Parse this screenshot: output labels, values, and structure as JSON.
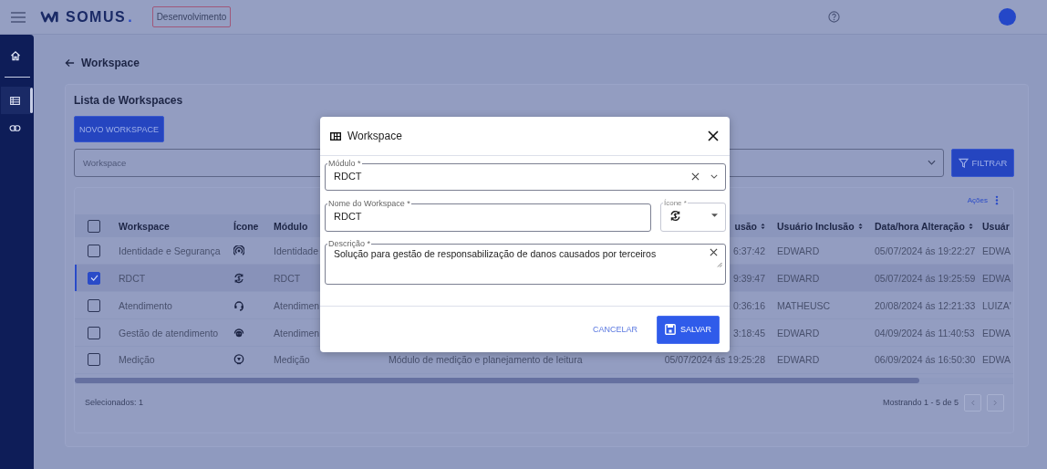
{
  "app_bar": {
    "logo_text": "SOMUS",
    "logo_dot": ".",
    "environment_badge": "Desenvolvimento"
  },
  "sidebar": {
    "items": [
      {
        "kind": "home",
        "selected": false
      },
      {
        "kind": "list",
        "selected": true
      },
      {
        "kind": "link",
        "selected": false
      }
    ]
  },
  "page_title": "Workspace",
  "card": {
    "title": "Lista de Workspaces",
    "new_button": "NOVO WORKSPACE",
    "filter": {
      "placeholder": "Workspace"
    },
    "filter_button": "FILTRAR",
    "actions": "Ações"
  },
  "table": {
    "select_all_checked": false,
    "columns": [
      {
        "label": "Workspace",
        "sortable": false
      },
      {
        "label": "Ícone",
        "sortable": false
      },
      {
        "label": "Módulo",
        "sortable": false
      },
      {
        "label": "usão",
        "sortable": true
      },
      {
        "label": "Usuário Inclusão",
        "sortable": true
      },
      {
        "label": "Data/hora Alteração",
        "sortable": true
      },
      {
        "label": "Usuár",
        "sortable": false
      }
    ],
    "rows": [
      {
        "selected": false,
        "workspace": "Identidade e Segurança",
        "modulo": "Identidade",
        "data_inclusao": "6:37:42",
        "usuario_inclusao": "EDWARD",
        "data_alteracao": "05/07/2024 ás 19:22:27",
        "column_9": "EDWA"
      },
      {
        "selected": true,
        "workspace": "RDCT",
        "modulo": "RDCT",
        "data_inclusao": "9:39:47",
        "usuario_inclusao": "EDWARD",
        "data_alteracao": "05/07/2024 ás 19:25:59",
        "column_9": "EDWA"
      },
      {
        "selected": false,
        "workspace": "Atendimento",
        "modulo": "Atendimen",
        "data_inclusao": "0:36:16",
        "usuario_inclusao": "MATHEUSC",
        "data_alteracao": "20/08/2024 ás 12:21:33",
        "column_9": "LUIZA'"
      },
      {
        "selected": false,
        "workspace": "Gestão de atendimento",
        "modulo": "Atendimen",
        "data_inclusao": "3:18:45",
        "usuario_inclusao": "EDWARD",
        "data_alteracao": "04/09/2024 ás 11:40:53",
        "column_9": "EDWA"
      },
      {
        "selected": false,
        "workspace": "Medição",
        "modulo": "Medição",
        "descricao": "Módulo de medição e planejamento de leitura",
        "data_inclusao": "05/07/2024 ás 19:25:28",
        "usuario_inclusao": "EDWARD",
        "data_alteracao": "06/09/2024 ás 16:50:30",
        "column_9": "EDWA"
      }
    ],
    "selected_count": "Selecionados: 1",
    "showing": "Mostrando 1 - 5 de 5"
  },
  "dialog": {
    "title": "Workspace",
    "modulo": {
      "label": "Módulo *",
      "value": "RDCT"
    },
    "nome": {
      "label": "Nome do Workspace *",
      "value": "RDCT"
    },
    "icone": {
      "label": "Ícone *"
    },
    "descricao": {
      "label": "Descrição *",
      "value": "Solução para gestão de responsabilização de danos causados por terceiros"
    },
    "cancel_button": "CANCELAR",
    "save_button": "SALVAR"
  }
}
